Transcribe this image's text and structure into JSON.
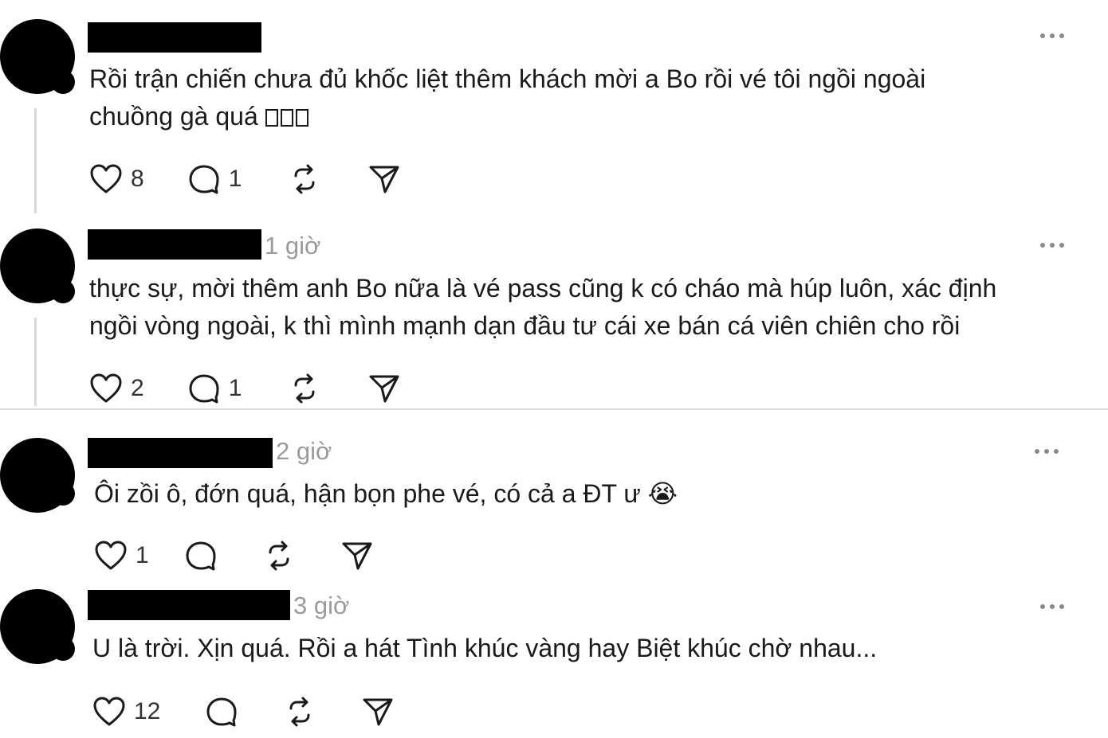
{
  "comments": [
    {
      "time": "",
      "text_lines": [
        "Rồi trận chiến chưa đủ khốc liệt thêm khách mời a Bo rồi vé tôi ngồi ngoài",
        "chuồng gà quá"
      ],
      "likes": "8",
      "replies": "1"
    },
    {
      "time": "1 giờ",
      "text_lines": [
        "thực sự, mời thêm anh Bo nữa là vé pass cũng k có cháo mà húp luôn, xác định",
        "ngồi vòng ngoài, k thì mình mạnh dạn đầu tư cái xe bán cá viên chiên cho rồi"
      ],
      "likes": "2",
      "replies": "1"
    },
    {
      "time": "2 giờ",
      "text_lines": [
        "Ôi zồi ô, đớn quá, hận bọn phe vé, có cả a ĐT ư 😭"
      ],
      "likes": "1",
      "replies": ""
    },
    {
      "time": "3 giờ",
      "text_lines": [
        "U là trời. Xịn quá. Rồi a hát Tình khúc vàng hay Biệt khúc chờ nhau..."
      ],
      "likes": "12",
      "replies": ""
    }
  ],
  "icons": {
    "like": "heart-icon",
    "reply": "comment-icon",
    "repost": "repost-icon",
    "share": "send-icon",
    "more": "more-icon"
  },
  "colors": {
    "text": "#1a1a1a",
    "muted": "#9a9a9a",
    "divider": "#dcdcdc"
  }
}
